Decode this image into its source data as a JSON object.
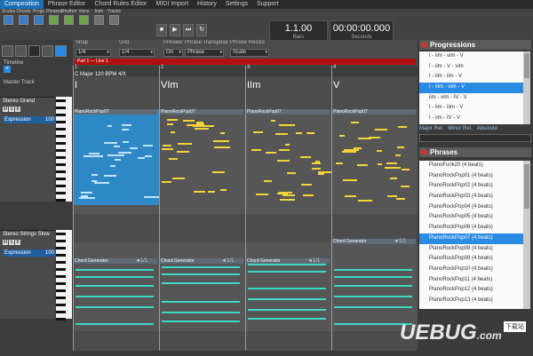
{
  "menu": [
    "Composition",
    "Phrase Editor",
    "Chord Rules Editor",
    "MIDI Import",
    "History",
    "Settings",
    "Support"
  ],
  "tool_buttons": [
    "Scales",
    "Chords",
    "Progs",
    "Phrases",
    "Rhythm",
    "Voice",
    "Instr",
    "Tracks"
  ],
  "transport_icons": [
    "stop-icon",
    "play-icon",
    "next-icon",
    "loop-icon"
  ],
  "position": {
    "bars": "1.1.00",
    "bars_label": "Bars",
    "seconds": "00:00:00.000",
    "seconds_label": "Seconds"
  },
  "controls": {
    "snap_label": "Snap",
    "snap_value": "1/4",
    "grid_label": "Grid",
    "grid_value": "1/4",
    "preview_label": "Preview",
    "preview_value": "On",
    "transpose_label": "Phrase Transpose",
    "transpose_value": "Phrase",
    "resize_label": "Phrase Resize",
    "resize_value": "Scale"
  },
  "part_label": "Part 1 — Line 1",
  "timeline": {
    "label": "Timeline",
    "key_info": "C Major  120 BPM  4/X",
    "bars": [
      "1",
      "2",
      "3",
      "4"
    ],
    "chords": [
      "I",
      "VIm",
      "IIm",
      "V"
    ]
  },
  "tracks": {
    "master": "Master Track",
    "t1": {
      "name": "Stereo Grand",
      "expression": "Expression",
      "value": "100"
    },
    "t2": {
      "name": "Stereo Strings Slow",
      "expression": "Expression",
      "value": "100"
    },
    "msb": [
      "M",
      "S",
      "B"
    ]
  },
  "lane1_phrases": [
    "PianoRockPop07",
    "PianoRockPop07",
    "PianoRockPop07",
    "PianoRockPop07"
  ],
  "lane2_phrases": [
    "Chord Generator",
    "Chord Generator",
    "Chord Generator",
    "Chord Generator"
  ],
  "lane2_badges": [
    "◄1/1",
    "◄1/1",
    "◄1/1",
    "◄1/1"
  ],
  "progressions": {
    "title": "Progressions",
    "items": [
      "I - iim - vim - V",
      "I - iim - V - vim",
      "I - iim - iim - V",
      "I - iiim - vim - V",
      "iim - vim - IV - V",
      "I - iim - iiim - V",
      "I - iim - IV - V"
    ],
    "selected": 3,
    "filters": [
      "Major Rel.",
      "Minor Rel.",
      "Absolute"
    ]
  },
  "phrases": {
    "title": "Phrases",
    "items": [
      "PianoFunk20 (4 beats)",
      "PianoRockPop01 (4 beats)",
      "PianoRockPop02 (4 beats)",
      "PianoRockPop03 (4 beats)",
      "PianoRockPop04 (4 beats)",
      "PianoRockPop05 (4 beats)",
      "PianoRockPop06 (4 beats)",
      "PianoRockPop07 (4 beats)",
      "PianoRockPop08 (4 beats)",
      "PianoRockPop09 (4 beats)",
      "PianoRockPop10 (4 beats)",
      "PianoRockPop11 (4 beats)",
      "PianoRockPop12 (4 beats)",
      "PianoRockPop13 (4 beats)"
    ],
    "selected": 7
  },
  "watermark": {
    "text": "UEBUG",
    "suffix": ".com",
    "badge": "下载站"
  },
  "colors": {
    "accent": "#2b8ae2",
    "part_bar": "#b01010",
    "note_yellow": "#f3d43a",
    "note_cyan": "#3ed9c4",
    "note_light": "#bfe3ff",
    "selected_phrase": "#2f88c6"
  }
}
